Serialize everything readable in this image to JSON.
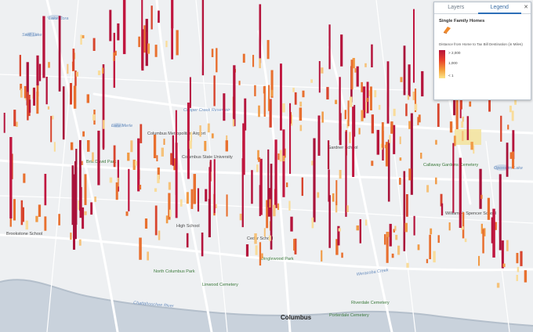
{
  "map": {
    "labels": {
      "lake_cora": "Lake Cora",
      "swift_lake": "Swift Lake",
      "lake_merle": "Lake Merle",
      "cooper_creek_reservoir": "Cooper Creek Reservoir",
      "metro_airport": "Columbus Metropolitan Airport",
      "columbus_state_university": "Columbus State University",
      "britt_david_park": "Britt David Park",
      "gardner_school": "Gardner School",
      "brookstone_school": "Brookstone School",
      "cedar_school": "Cedar School",
      "high_school": "High School",
      "dinglewood_park": "Dinglewood Park",
      "north_columbus_park": "North Columbus Park",
      "linwood_cemetery": "Linwood Cemetery",
      "riverdale_cemetery": "Riverdale Cemetery",
      "porterdale_cemetery": "Porterdale Cemetery",
      "columbus": "Columbus",
      "chattahoochee_river": "Chattahoochee River",
      "weracoba_creek": "Weracoba Creek",
      "callaway_gardens_cemetery": "Callaway Gardens Cemetery",
      "opossum_lake": "Opossum Lake",
      "william_fitzgerald_school": "William H. Spencer School"
    }
  },
  "legend_panel": {
    "tabs": [
      {
        "label": "Layers",
        "active": false
      },
      {
        "label": "Legend",
        "active": true
      }
    ],
    "close_icon": "close-icon",
    "layer_title": "Single Family Homes",
    "layer_symbol_icon": "extruded-bar-symbol",
    "field_label": "Distance from Home to Tax Bill Destination (in Miles)",
    "ramp": {
      "labels": [
        "> 2,000",
        "1,000",
        "< 1"
      ],
      "colors": [
        "#b5143c",
        "#e8402b",
        "#f59e3b",
        "#fbe58a"
      ]
    }
  }
}
